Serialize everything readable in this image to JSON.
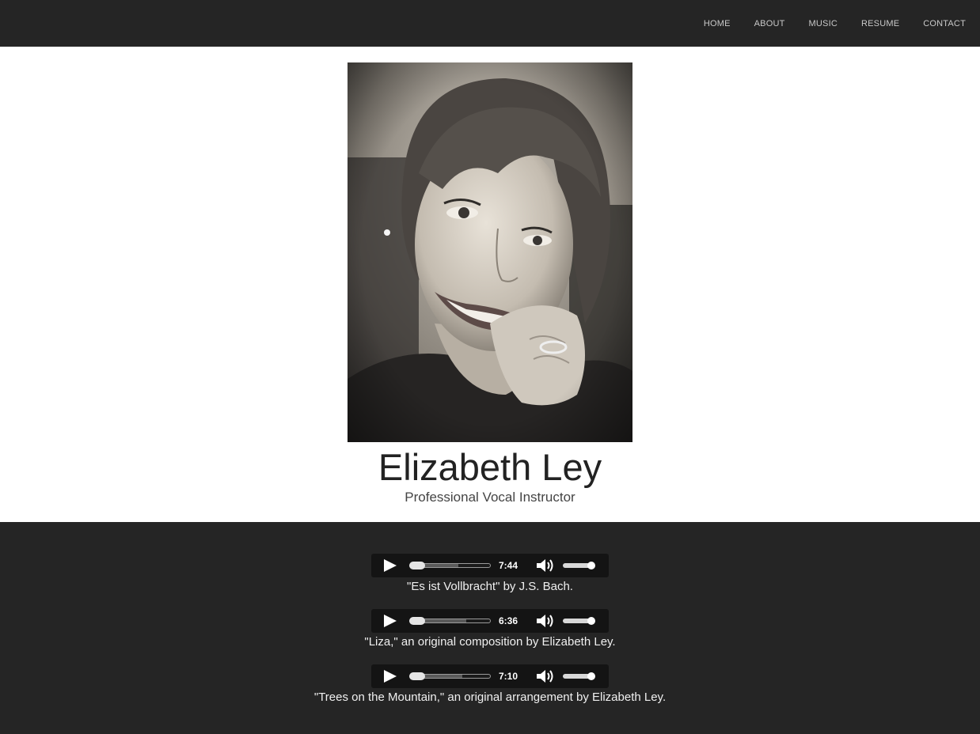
{
  "nav": {
    "items": [
      "HOME",
      "ABOUT",
      "MUSIC",
      "RESUME",
      "CONTACT"
    ]
  },
  "profile": {
    "name": "Elizabeth Ley",
    "title": "Professional Vocal Instructor"
  },
  "tracks": [
    {
      "duration": "7:44",
      "caption": "\"Es ist Vollbracht\" by J.S. Bach.",
      "buffered": 0.6
    },
    {
      "duration": "6:36",
      "caption": "\"Liza,\" an original composition by Elizabeth Ley.",
      "buffered": 0.7
    },
    {
      "duration": "7:10",
      "caption": "\"Trees on the Mountain,\" an original arrangement by Elizabeth Ley.",
      "buffered": 0.65
    }
  ],
  "icons": {
    "play": "play-icon",
    "volume": "volume-icon"
  },
  "colors": {
    "header_bg": "#252525",
    "music_bg": "#252525",
    "player_bg": "#141414",
    "nav_text": "#c9c9c9"
  }
}
